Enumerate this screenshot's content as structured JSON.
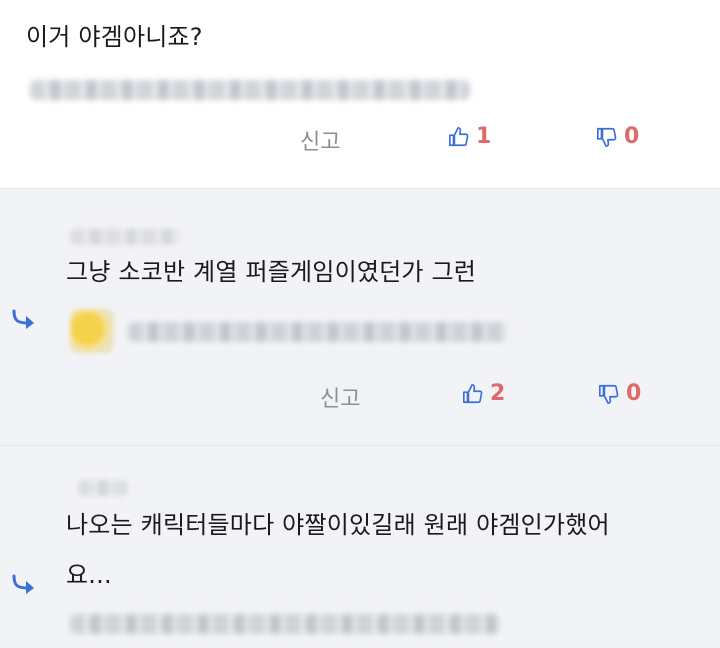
{
  "comments": [
    {
      "text": "이거 야겜아니죠?",
      "report_label": "신고",
      "likes": "1",
      "dislikes": "0"
    },
    {
      "text": "그냥 소코반 계열 퍼즐게임이였던가 그런",
      "report_label": "신고",
      "likes": "2",
      "dislikes": "0",
      "is_reply": true
    },
    {
      "text_line1": "나오는 캐릭터들마다 야짤이있길래 원래 야겜인가했어",
      "text_line2": "요...",
      "is_reply": true
    }
  ],
  "colors": {
    "reply_arrow": "#3b6fd8",
    "like_icon": "#3b6fd8",
    "count": "#e06a6a",
    "report": "#8c8f96"
  },
  "icons": [
    "thumbs-up-icon",
    "thumbs-down-icon",
    "reply-arrow-icon"
  ]
}
